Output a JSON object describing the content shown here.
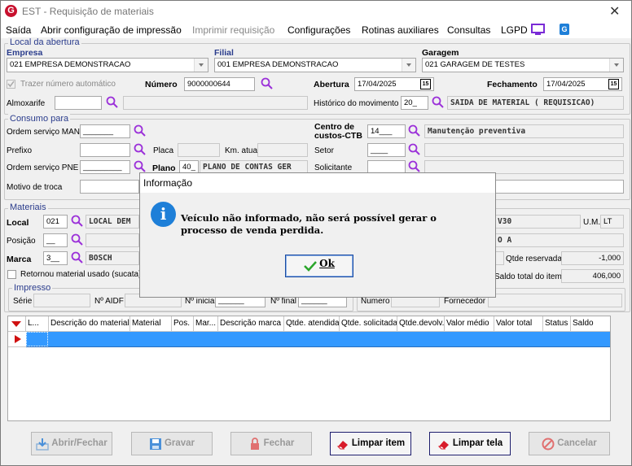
{
  "window": {
    "title": "EST - Requisição de materiais",
    "close": "✕",
    "logo": "G"
  },
  "menu": [
    {
      "label": "Saída",
      "enabled": true
    },
    {
      "label": "Abrir configuração de impressão",
      "enabled": true
    },
    {
      "label": "Imprimir requisição",
      "enabled": false
    },
    {
      "label": "Configurações",
      "enabled": true
    },
    {
      "label": "Rotinas auxiliares",
      "enabled": true
    },
    {
      "label": "Consultas",
      "enabled": true
    },
    {
      "label": "LGPD",
      "enabled": true
    }
  ],
  "local": {
    "group": "Local da abertura",
    "empresa_label": "Empresa",
    "empresa_value": "021 EMPRESA DEMONSTRACAO",
    "filial_label": "Filial",
    "filial_value": "001 EMPRESA DEMONSTRACAO",
    "garagem_label": "Garagem",
    "garagem_value": "021 GARAGEM DE TESTES",
    "auto_label": "Trazer número automático",
    "numero_label": "Número",
    "numero_value": "9000000644",
    "abertura_label": "Abertura",
    "abertura_value": "17/04/2025",
    "fechamento_label": "Fechamento",
    "fechamento_value": "17/04/2025",
    "cal": "15",
    "almox_label": "Almoxarife",
    "almox_value": "",
    "historico_label": "Histórico do movimento",
    "historico_code": "20_",
    "historico_desc": "SAIDA DE MATERIAL ( REQUISICAO)"
  },
  "consumo": {
    "group": "Consumo para",
    "os_man_label": "Ordem serviço MAN",
    "os_man_value": "_______",
    "prefixo_label": "Prefixo",
    "placa_label": "Placa",
    "km_label": "Km. atual",
    "os_pne_label": "Ordem serviço PNE",
    "os_pne_value": "_________",
    "plano_label": "Plano",
    "plano_code": "40_",
    "plano_desc": "PLANO DE CONTAS GER",
    "motivo_label": "Motivo de troca",
    "centro_label": "Centro de custos-CTB",
    "centro_code": "14___",
    "centro_desc": "Manutenção preventiva",
    "setor_label": "Setor",
    "setor_value": "____",
    "solicitante_label": "Solicitante"
  },
  "materiais": {
    "group": "Materiais",
    "local_label": "Local",
    "local_code": "021",
    "local_desc": "LOCAL DEM",
    "posicao_label": "Posição",
    "posicao_value": "__",
    "marca_label": "Marca",
    "marca_code": "3__",
    "marca_desc": "BOSCH",
    "retornou_label": "Retornou material usado (sucata)",
    "um_label": "U.M.",
    "um_value": "LT",
    "right_desc": "V30",
    "right_desc2": "O A",
    "qtde_reservada_label": "Qtde reservada",
    "qtde_reservada_value": "-1,000",
    "saldo_total_label": "Saldo total do item",
    "saldo_total_value": "406,000"
  },
  "impresso": {
    "group": "Impresso",
    "serie_label": "Série",
    "aidf_label": "Nº AIDF",
    "inicial_label": "Nº inicial",
    "inicial_value": "______",
    "final_label": "Nº final",
    "final_value": "______",
    "numero_label": "Numero",
    "fornecedor_label": "Fornecedor"
  },
  "grid": {
    "columns": [
      "L...",
      "Descrição do material",
      "Material",
      "Pos.",
      "Mar...",
      "Descrição marca",
      "Qtde. atendida",
      "Qtde. solicitada",
      "Qtde.devolv.",
      "Valor médio",
      "Valor total",
      "Status",
      "Saldo"
    ]
  },
  "buttons": [
    {
      "label": "Abrir/Fechar",
      "enabled": false,
      "icon": "download-icon"
    },
    {
      "label": "Gravar",
      "enabled": false,
      "icon": "save-icon"
    },
    {
      "label": "Fechar",
      "enabled": false,
      "icon": "lock-icon"
    },
    {
      "label": "Limpar item",
      "enabled": true,
      "icon": "eraser-icon"
    },
    {
      "label": "Limpar tela",
      "enabled": true,
      "icon": "eraser-icon"
    },
    {
      "label": "Cancelar",
      "enabled": false,
      "icon": "cancel-icon"
    }
  ],
  "dialog": {
    "title": "Informação",
    "icon": "i",
    "message": "Veículo não informado, não será possível gerar o processo de venda perdida.",
    "ok": "Ok"
  },
  "colors": {
    "accent": "#7a2bd6",
    "group_label": "#2a3c8c",
    "selection": "#3399ff"
  }
}
